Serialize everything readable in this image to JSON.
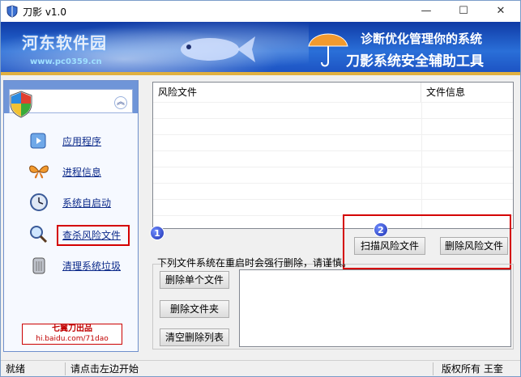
{
  "window": {
    "title": "刀影 v1.0",
    "minimize_glyph": "—",
    "maximize_glyph": "☐",
    "close_glyph": "✕"
  },
  "banner": {
    "watermark_title": "河东软件园",
    "watermark_url": "www.pc0359.cn",
    "slogan_line1": "诊断优化管理你的系统",
    "slogan_line2": "刀影系统安全辅助工具"
  },
  "sidebar": {
    "collapse_glyph": "︽",
    "items": [
      {
        "label": "应用程序",
        "icon": "app-window-icon"
      },
      {
        "label": "进程信息",
        "icon": "butterfly-icon"
      },
      {
        "label": "系统自启动",
        "icon": "clock-icon"
      },
      {
        "label": "查杀风险文件",
        "icon": "magnifier-icon"
      },
      {
        "label": "清理系统垃圾",
        "icon": "trash-bin-icon"
      }
    ],
    "active_index": 3,
    "badge_title": "七翼刀出品",
    "badge_url": "hi.baidu.com/71dao"
  },
  "main": {
    "list_columns": [
      "风险文件",
      "文件信息"
    ],
    "marker1": "1",
    "marker2": "2",
    "scan_button": "扫描风险文件",
    "delete_button": "删除风险文件",
    "note": "下列文件系统在重启时会强行删除，请谨慎。",
    "delete_file_button": "删除单个文件",
    "delete_folder_button": "删除文件夹",
    "clear_list_button": "清空删除列表"
  },
  "status": {
    "ready": "就绪",
    "hint": "请点击左边开始",
    "copyright": "版权所有 王奎"
  },
  "colors": {
    "banner_blue": "#1b4fc0",
    "highlight_red": "#d40000",
    "link_blue": "#0c2a8a"
  }
}
